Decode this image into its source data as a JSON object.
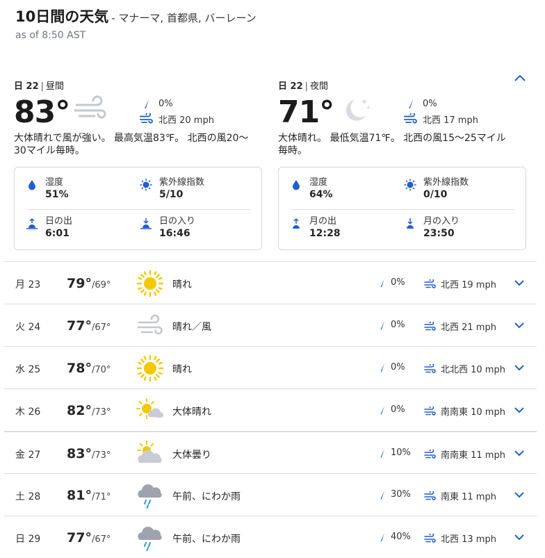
{
  "header": {
    "title": "10日間の天気",
    "location": "- マナーマ, 首都県, バーレーン",
    "as_of": "as of 8:50 AST"
  },
  "day_panel": {
    "date": "日 22",
    "sep": "|",
    "part": "昼間",
    "temp": "83°",
    "precip": "0%",
    "wind": "北西 20 mph",
    "desc": "大体晴れで風が強い。 最高気温83℉。 北西の風20～30マイル毎時。",
    "details": {
      "humidity_label": "湿度",
      "humidity": "51%",
      "uv_label": "紫外線指数",
      "uv": "5/10",
      "rise_label": "日の出",
      "rise": "6:01",
      "set_label": "日の入り",
      "set": "16:46"
    }
  },
  "night_panel": {
    "date": "日 22",
    "sep": "|",
    "part": "夜間",
    "temp": "71°",
    "precip": "0%",
    "wind": "北西 17 mph",
    "desc": "大体晴れ。 最低気温71℉。 北西の風15～25マイル毎時。",
    "details": {
      "humidity_label": "湿度",
      "humidity": "64%",
      "uv_label": "紫外線指数",
      "uv": "0/10",
      "rise_label": "月の出",
      "rise": "12:28",
      "set_label": "月の入り",
      "set": "23:50"
    }
  },
  "days": [
    {
      "date": "月 23",
      "hi": "79°",
      "lo": "/69°",
      "icon": "sun-icon",
      "phrase": "晴れ",
      "precip": "0%",
      "wind": "北西 19 mph"
    },
    {
      "date": "火 24",
      "hi": "77°",
      "lo": "/67°",
      "icon": "wind-icon",
      "phrase": "晴れ／風",
      "precip": "0%",
      "wind": "北西 21 mph"
    },
    {
      "date": "水 25",
      "hi": "78°",
      "lo": "/70°",
      "icon": "sun-icon",
      "phrase": "晴れ",
      "precip": "0%",
      "wind": "北北西 10 mph"
    },
    {
      "date": "木 26",
      "hi": "82°",
      "lo": "/73°",
      "icon": "mostly-sunny-icon",
      "phrase": "大体晴れ",
      "precip": "0%",
      "wind": "南南東 10 mph"
    },
    {
      "date": "金 27",
      "hi": "83°",
      "lo": "/73°",
      "icon": "partly-cloudy-icon",
      "phrase": "大体曇り",
      "precip": "10%",
      "wind": "南南東 11 mph"
    },
    {
      "date": "土 28",
      "hi": "81°",
      "lo": "/71°",
      "icon": "showers-icon",
      "phrase": "午前、にわか雨",
      "precip": "30%",
      "wind": "南東 11 mph"
    },
    {
      "date": "日 29",
      "hi": "77°",
      "lo": "/67°",
      "icon": "showers-icon",
      "phrase": "午前、にわか雨",
      "precip": "40%",
      "wind": "北西 13 mph"
    }
  ],
  "colors": {
    "accent_blue": "#1f5fcf",
    "sun_yellow": "#f6c800",
    "cloud_gray": "#c9ccd3",
    "rain_blue": "#3aa0dc"
  }
}
